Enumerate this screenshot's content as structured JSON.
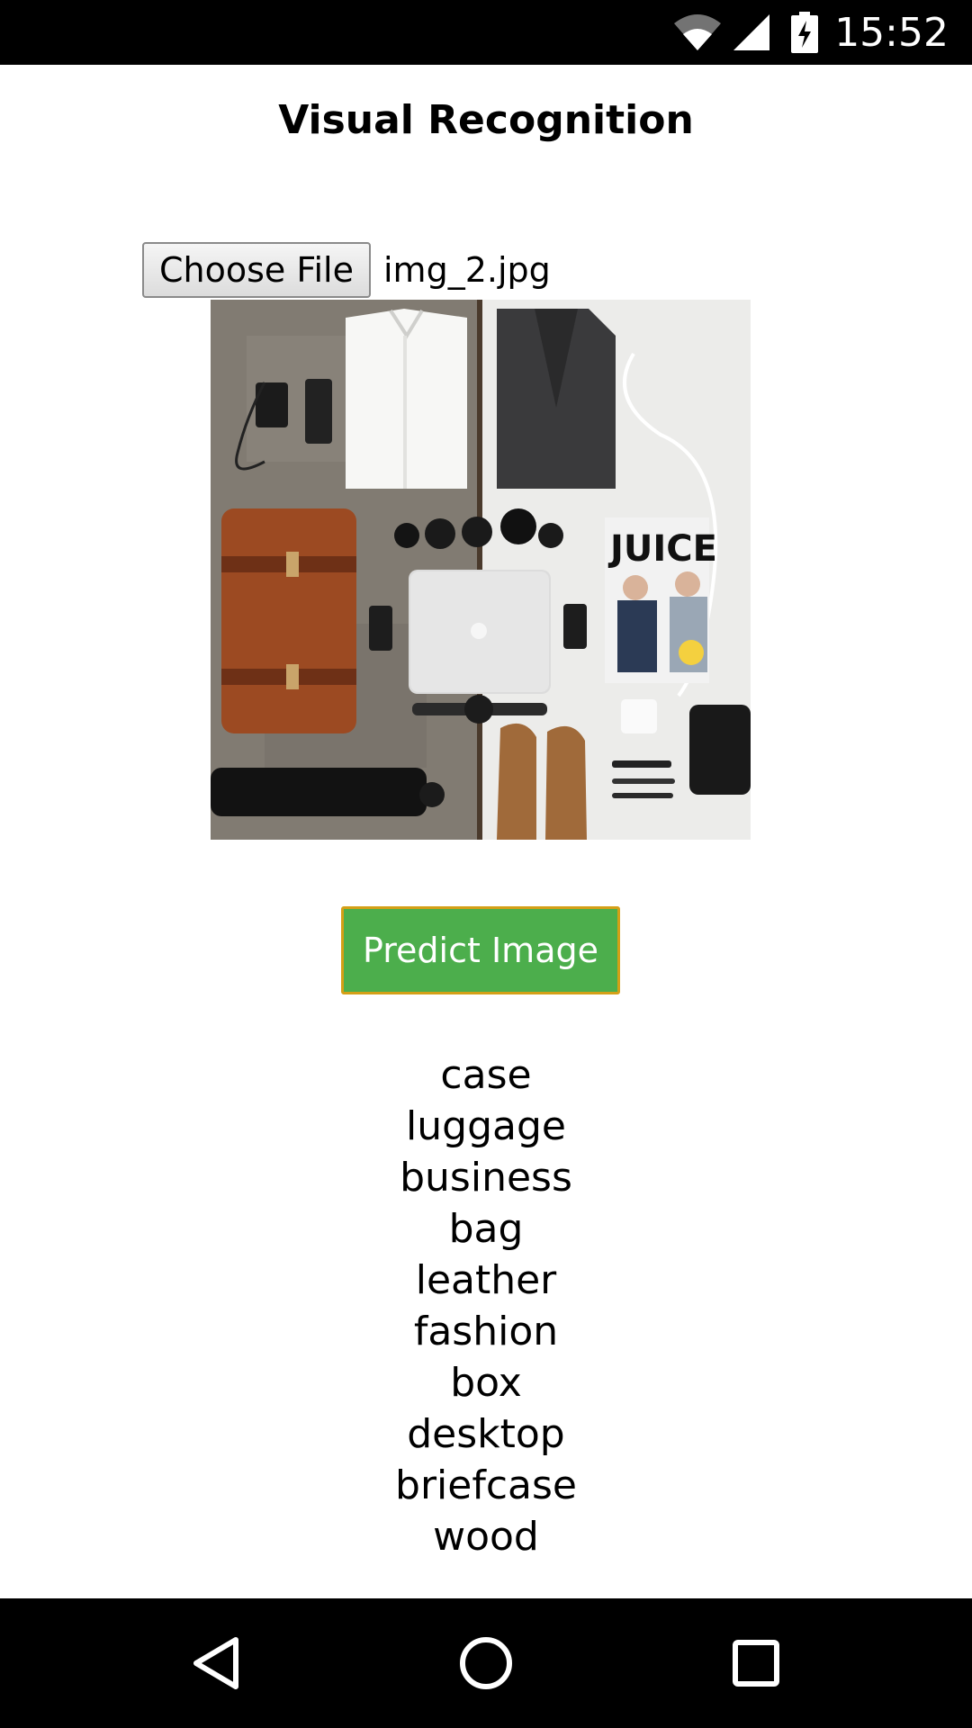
{
  "status_bar": {
    "time": "15:52",
    "icons": [
      "wifi-icon",
      "cell-signal-icon",
      "battery-charging-icon"
    ]
  },
  "page": {
    "title": "Visual Recognition"
  },
  "file_input": {
    "button_label": "Choose File",
    "file_name": "img_2.jpg"
  },
  "image_preview": {
    "magazine_title": "JUICE"
  },
  "predict_button": {
    "label": "Predict Image",
    "color": "#4cae4c",
    "border_color": "#d4a017"
  },
  "predictions": [
    "case",
    "luggage",
    "business",
    "bag",
    "leather",
    "fashion",
    "box",
    "desktop",
    "briefcase",
    "wood"
  ],
  "nav_bar": {
    "icons": [
      "back-icon",
      "home-icon",
      "recents-icon"
    ]
  }
}
